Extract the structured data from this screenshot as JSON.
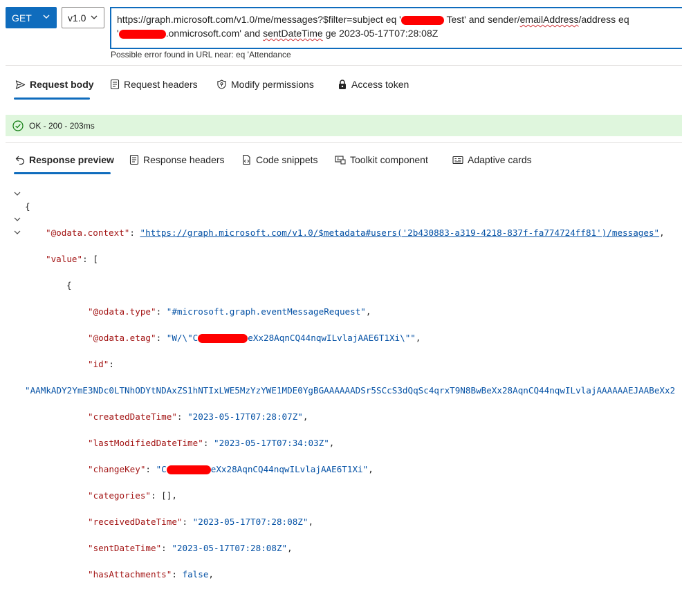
{
  "request": {
    "method": "GET",
    "version": "v1.0",
    "url_line1_a": "https://graph.microsoft.com/v1.0/me/messages?$filter=subject eq '",
    "url_line1_b": "Test' and sender/",
    "url_line1_c": "emailAddress",
    "url_line1_d": "/address eq",
    "url_line2_a": "'",
    "url_line2_b": ".onmicrosoft.com' and ",
    "url_line2_c": "sentDateTime",
    "url_line2_d": " ge 2023-05-17T07:28:08Z",
    "error_text": "Possible error found in URL near: eq 'Attendance"
  },
  "request_tabs": [
    {
      "label": "Request body",
      "icon": "send-icon"
    },
    {
      "label": "Request headers",
      "icon": "document-icon"
    },
    {
      "label": "Modify permissions",
      "icon": "shield-icon"
    },
    {
      "label": "Access token",
      "icon": "lock-icon"
    }
  ],
  "status": {
    "text": "OK - 200 - 203ms",
    "color": "#dff6dd"
  },
  "response_tabs": [
    {
      "label": "Response preview",
      "icon": "undo-arrow-icon"
    },
    {
      "label": "Response headers",
      "icon": "document-icon"
    },
    {
      "label": "Code snippets",
      "icon": "code-snippet-icon"
    },
    {
      "label": "Toolkit component",
      "icon": "toolkit-icon"
    },
    {
      "label": "Adaptive cards",
      "icon": "card-icon"
    }
  ],
  "json": {
    "odata_context_key": "\"@odata.context\"",
    "odata_context_val": "\"https://graph.microsoft.com/v1.0/$metadata#users('2b430883-a319-4218-837f-fa774724ff81')/messages\"",
    "value_key": "\"value\"",
    "odata_type_key": "\"@odata.type\"",
    "odata_type_val": "\"#microsoft.graph.eventMessageRequest\"",
    "odata_etag_key": "\"@odata.etag\"",
    "odata_etag_val_a": "\"W/\\\"C",
    "odata_etag_val_b": "eXx28AqnCQ44nqwILvlajAAE6T1Xi\\\"\"",
    "id_key": "\"id\"",
    "id_val": "\"AAMkADY2YmE3NDc0LTNhODYtNDAxZS1hNTIxLWE5MzYzYWE1MDE0YgBGAAAAAADSr5SCcS3dQqSc4qrxT9N8BwBeXx28AqnCQ44nqwILvlajAAAAAAEJAABeXx2",
    "created_key": "\"createdDateTime\"",
    "created_val": "\"2023-05-17T07:28:07Z\"",
    "modified_key": "\"lastModifiedDateTime\"",
    "modified_val": "\"2023-05-17T07:34:03Z\"",
    "changekey_key": "\"changeKey\"",
    "changekey_val_a": "\"C",
    "changekey_val_b": "eXx28AqnCQ44nqwILvlajAAE6T1Xi\"",
    "categories_key": "\"categories\"",
    "categories_val": "[]",
    "received_key": "\"receivedDateTime\"",
    "received_val": "\"2023-05-17T07:28:08Z\"",
    "sent_key": "\"sentDateTime\"",
    "sent_val": "\"2023-05-17T07:28:08Z\"",
    "attach_key": "\"hasAttachments\"",
    "attach_val": "false"
  }
}
